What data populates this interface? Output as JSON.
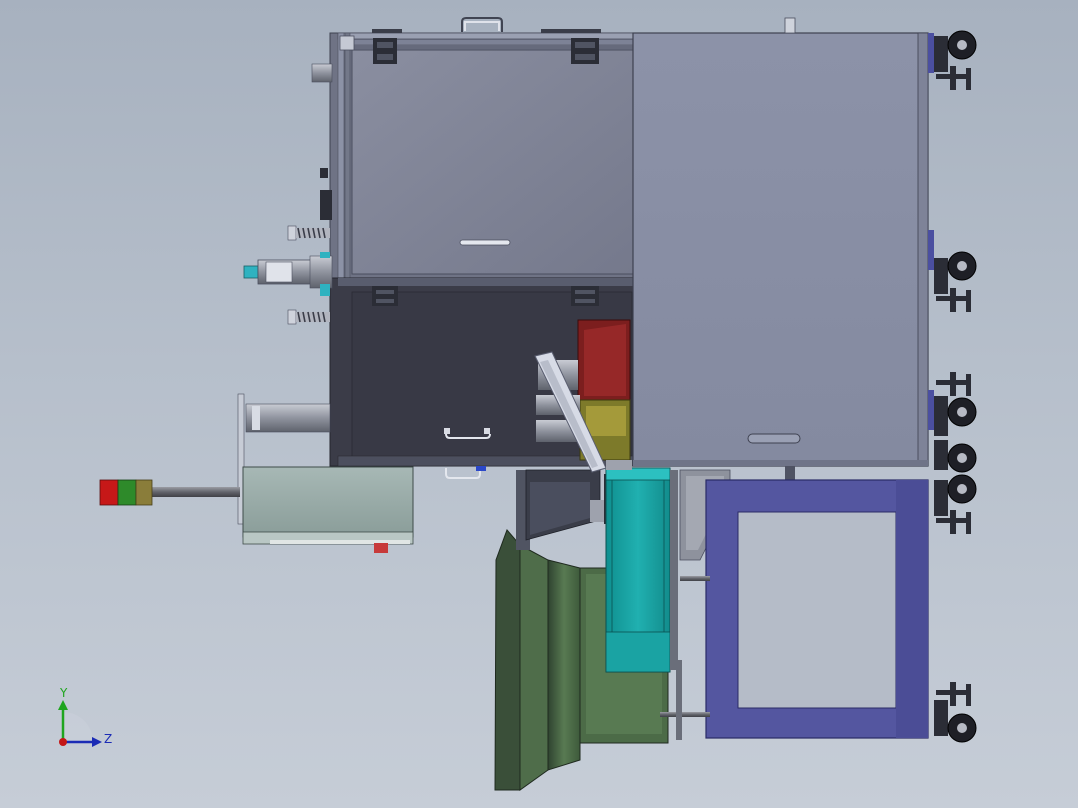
{
  "viewport": {
    "background_top": "#a7b1bf",
    "background_bottom": "#c6cdd7"
  },
  "model": {
    "part_colors": {
      "cabinet_upper": "#7f8496",
      "cabinet_lower": "#3b3c48",
      "cabinet_right": "#878da3",
      "frame_edge": "#5a5e70",
      "control_box": "#98aaa6",
      "feeder_bowl": "#4c6b47",
      "linear_feeder": "#17a2a2",
      "support_frame": "#5456a0",
      "guide_rail": "#d7dbe6",
      "gripper_block": "#7c1e1e",
      "gripper_base": "#7d7a2a",
      "signal_red": "#c61818",
      "signal_green": "#2e8a2a",
      "signal_amber": "#8a7d3a"
    },
    "icons": [
      "caster-wheel-icon",
      "leveling-foot-icon",
      "hinge-icon",
      "handle-icon",
      "signal-tower-icon"
    ]
  },
  "triad": {
    "y_label": "Y",
    "z_label": "Z",
    "y_color": "#1fa51f",
    "z_color": "#1b2bb5",
    "x_color": "#c41616"
  }
}
